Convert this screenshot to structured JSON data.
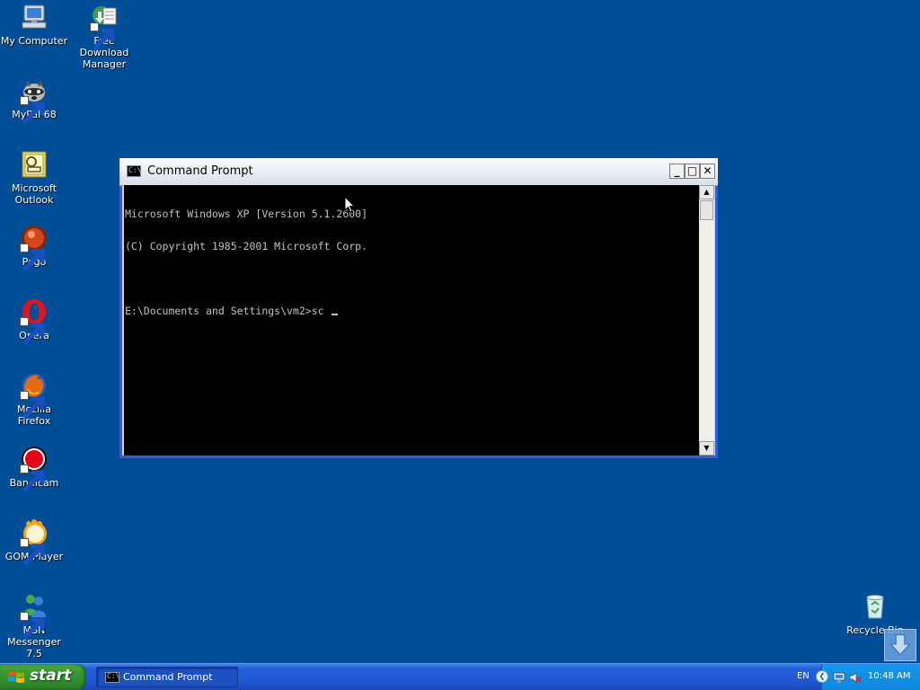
{
  "desktop": {
    "icons": [
      {
        "label": "My Computer",
        "icon": "computer-icon"
      },
      {
        "label": "Free Download Manager",
        "icon": "download-manager-icon"
      },
      {
        "label": "MyPal 68",
        "icon": "mypal-raccoon-icon"
      },
      {
        "label": "Microsoft Outlook",
        "icon": "outlook-icon"
      },
      {
        "label": "Pego",
        "icon": "pego-icon"
      },
      {
        "label": "Opera",
        "icon": "opera-icon"
      },
      {
        "label": "Mozilla Firefox",
        "icon": "firefox-icon"
      },
      {
        "label": "Bandicam",
        "icon": "bandicam-icon"
      },
      {
        "label": "GOM Player",
        "icon": "gom-player-icon"
      },
      {
        "label": "MSN Messenger 7.5",
        "icon": "msn-messenger-icon"
      },
      {
        "label": "Recycle Bin",
        "icon": "recycle-bin-icon"
      }
    ]
  },
  "window": {
    "title": "Command Prompt",
    "icon_text": "C:\\",
    "buttons": {
      "minimize": "_",
      "maximize": "□",
      "close": "✕"
    },
    "console_lines": [
      "Microsoft Windows XP [Version 5.1.2600]",
      "(C) Copyright 1985-2001 Microsoft Corp.",
      "",
      "E:\\Documents and Settings\\vm2>sc "
    ]
  },
  "taskbar": {
    "start_label": "start",
    "task_button_label": "Command Prompt",
    "language": "EN",
    "clock": "10:48 AM"
  },
  "colors": {
    "desktop_bg": "#004e98",
    "taskbar_blue": "#245edb",
    "start_green": "#3a9a36",
    "tray_blue": "#0e87dd",
    "console_bg": "#000000",
    "console_text": "#c0c0c0"
  }
}
